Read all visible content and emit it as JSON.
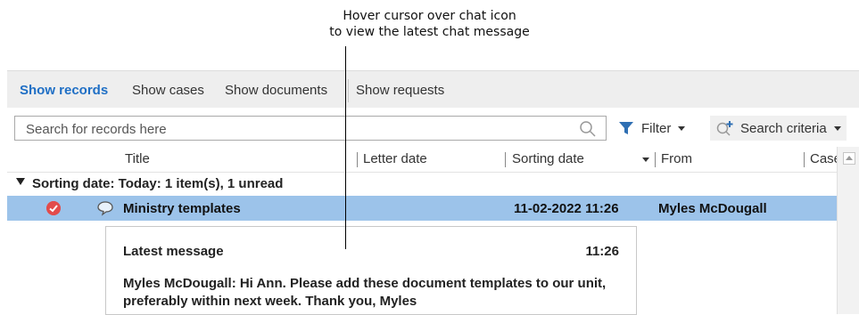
{
  "annotation": {
    "line1": "Hover cursor over chat icon",
    "line2": "to view the latest chat message"
  },
  "tabs": [
    {
      "label": "Show records",
      "active": true
    },
    {
      "label": "Show cases",
      "active": false
    },
    {
      "label": "Show documents",
      "active": false
    },
    {
      "label": "Show requests",
      "active": false
    }
  ],
  "search": {
    "placeholder": "Search for records here",
    "value": ""
  },
  "toolbar": {
    "filter_label": "Filter",
    "criteria_label": "Search criteria"
  },
  "columns": [
    "Title",
    "Letter date",
    "Sorting date",
    "From",
    "Case"
  ],
  "group": {
    "label": "Sorting date: Today: 1 item(s), 1 unread"
  },
  "record": {
    "title": "Ministry templates",
    "letter_date": "",
    "sorting_date": "11-02-2022 11:26",
    "from": "Myles McDougall"
  },
  "tooltip": {
    "title": "Latest message",
    "time": "11:26",
    "message_line1": "Myles McDougall: Hi Ann. Please add these document templates to our unit,",
    "message_line2": "preferably within next week. Thank you, Myles"
  },
  "colors": {
    "accent": "#1f6fc5",
    "selected_row": "#9cc3ea",
    "filter_icon": "#2f6fb3",
    "unread_check": "#e24b4b"
  },
  "icons": [
    "search-icon",
    "filter-icon",
    "add-search-icon",
    "check-icon",
    "chat-icon",
    "sort-caret-icon"
  ]
}
